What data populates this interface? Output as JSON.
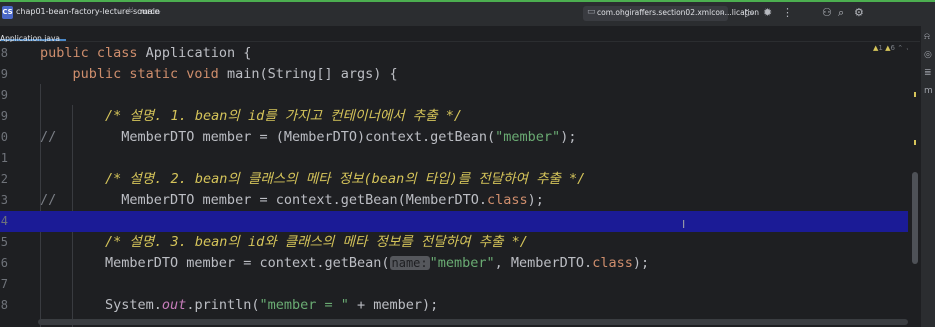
{
  "topbar": {
    "project_badge": "CS",
    "project_name": "chap01-bean-factory-lecture-source",
    "branch": "main",
    "run_config": "com.ohgiraffers.section02.xmlcon...lication",
    "icons": [
      "run-icon",
      "debug-icon",
      "more-icon",
      "add-user-icon",
      "search-icon",
      "settings-icon"
    ],
    "accent": "#4caf50"
  },
  "tabs": [
    {
      "label": "Application.java"
    }
  ],
  "inspection": {
    "warnings": "1",
    "weak_warnings": "6"
  },
  "editor": {
    "current_line_color": "#1b1b96",
    "lines": [
      {
        "num": "8",
        "comment_prefix": "",
        "tokens": [
          {
            "t": "public class ",
            "c": "kw"
          },
          {
            "t": "Application {",
            "c": ""
          }
        ]
      },
      {
        "num": "9",
        "comment_prefix": "",
        "tokens": [
          {
            "t": "    public static void ",
            "c": "kw"
          },
          {
            "t": "main(String[] args) {",
            "c": ""
          }
        ]
      },
      {
        "num": "9",
        "comment_prefix": "",
        "tokens": []
      },
      {
        "num": "9",
        "comment_prefix": "",
        "tokens": [
          {
            "t": "        /* 설명. 1. ",
            "c": "cmt"
          },
          {
            "t": "bean의 id를 가지고 컨테이너에서 추출 */",
            "c": "cmt"
          }
        ]
      },
      {
        "num": "0",
        "comment_prefix": "//",
        "tokens": [
          {
            "t": "          MemberDTO member = (MemberDTO)context.getBean(",
            "c": ""
          },
          {
            "t": "\"member\"",
            "c": "str"
          },
          {
            "t": ");",
            "c": ""
          }
        ]
      },
      {
        "num": "1",
        "comment_prefix": "",
        "tokens": []
      },
      {
        "num": "2",
        "comment_prefix": "",
        "tokens": [
          {
            "t": "        /* 설명. 2. bean의 클래스의 메타 정보(bean의 타입)를 전달하여 추출 */",
            "c": "cmt"
          }
        ]
      },
      {
        "num": "3",
        "comment_prefix": "//",
        "tokens": [
          {
            "t": "          MemberDTO member = context.getBean(MemberDTO.",
            "c": ""
          },
          {
            "t": "class",
            "c": "kw"
          },
          {
            "t": ");",
            "c": ""
          }
        ]
      },
      {
        "num": "4",
        "comment_prefix": "",
        "current": true,
        "tokens": []
      },
      {
        "num": "5",
        "comment_prefix": "",
        "tokens": [
          {
            "t": "        /* 설명. 3. bean의 id와 클래스의 메타 정보를 전달하여 추출 */",
            "c": "cmt"
          }
        ]
      },
      {
        "num": "6",
        "comment_prefix": "",
        "tokens": [
          {
            "t": "        MemberDTO member = context.getBean(",
            "c": ""
          },
          {
            "t": "name:",
            "c": "hint"
          },
          {
            "t": "\"member\"",
            "c": "str"
          },
          {
            "t": ", MemberDTO.",
            "c": ""
          },
          {
            "t": "class",
            "c": "kw"
          },
          {
            "t": ");",
            "c": ""
          }
        ]
      },
      {
        "num": "7",
        "comment_prefix": "",
        "tokens": []
      },
      {
        "num": "8",
        "comment_prefix": "",
        "tokens": [
          {
            "t": "        System.",
            "c": ""
          },
          {
            "t": "out",
            "c": "fld"
          },
          {
            "t": ".println(",
            "c": ""
          },
          {
            "t": "\"member = \"",
            "c": "str"
          },
          {
            "t": " + member);",
            "c": ""
          }
        ]
      }
    ]
  },
  "right_toolbar": [
    "notifications-icon",
    "ai-assistant-icon",
    "database-icon",
    "maven-icon"
  ]
}
